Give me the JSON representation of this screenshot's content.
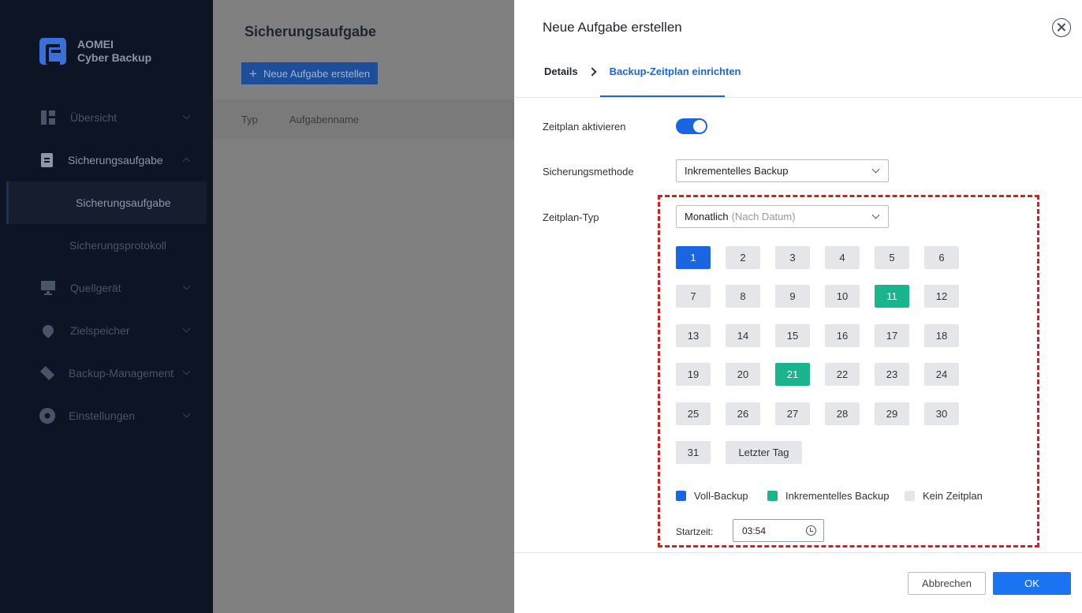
{
  "app": {
    "brand_line1": "AOMEI",
    "brand_line2": "Cyber Backup"
  },
  "sidebar": {
    "items": [
      {
        "label": "Übersicht",
        "icon": "dashboard-icon"
      },
      {
        "label": "Sicherungsaufgabe",
        "icon": "clipboard-icon",
        "expanded": true
      },
      {
        "label": "Quellgerät",
        "icon": "monitor-icon"
      },
      {
        "label": "Zielspeicher",
        "icon": "location-pin-icon"
      },
      {
        "label": "Backup-Management",
        "icon": "layers-icon"
      },
      {
        "label": "Einstellungen",
        "icon": "gear-icon"
      }
    ],
    "subitems": [
      {
        "label": "Sicherungsaufgabe",
        "active": true
      },
      {
        "label": "Sicherungsprotokoll",
        "active": false
      }
    ]
  },
  "main": {
    "title": "Sicherungsaufgabe",
    "new_task_button": "Neue Aufgabe erstellen",
    "columns": [
      "Typ",
      "Aufgabenname"
    ]
  },
  "drawer": {
    "title": "Neue Aufgabe erstellen",
    "steps": [
      "Details",
      "Backup-Zeitplan einrichten"
    ],
    "enable_schedule_label": "Zeitplan aktivieren",
    "enable_schedule_on": true,
    "method_label": "Sicherungsmethode",
    "method_value": "Inkrementelles Backup",
    "schedule_type_label": "Zeitplan-Typ",
    "schedule_type_value": "Monatlich",
    "schedule_type_hint": "(Nach Datum)",
    "days": [
      "1",
      "2",
      "3",
      "4",
      "5",
      "6",
      "7",
      "8",
      "9",
      "10",
      "11",
      "12",
      "13",
      "14",
      "15",
      "16",
      "17",
      "18",
      "19",
      "20",
      "21",
      "22",
      "23",
      "24",
      "25",
      "26",
      "27",
      "28",
      "29",
      "30",
      "31"
    ],
    "full_backup_days": [
      "1"
    ],
    "incremental_days": [
      "11",
      "21"
    ],
    "last_day_label": "Letzter Tag",
    "legend": {
      "full": "Voll-Backup",
      "incremental": "Inkrementelles Backup",
      "none": "Kein Zeitplan"
    },
    "start_time_label": "Startzeit:",
    "start_time_value": "03:54",
    "cancel_button": "Abbrechen",
    "ok_button": "OK"
  },
  "colors": {
    "accent": "#1a66e0",
    "incremental": "#1ab58c",
    "no_schedule": "#e4e6ea",
    "highlight_border": "#d81e1e",
    "sidebar_bg": "#0d1424"
  }
}
